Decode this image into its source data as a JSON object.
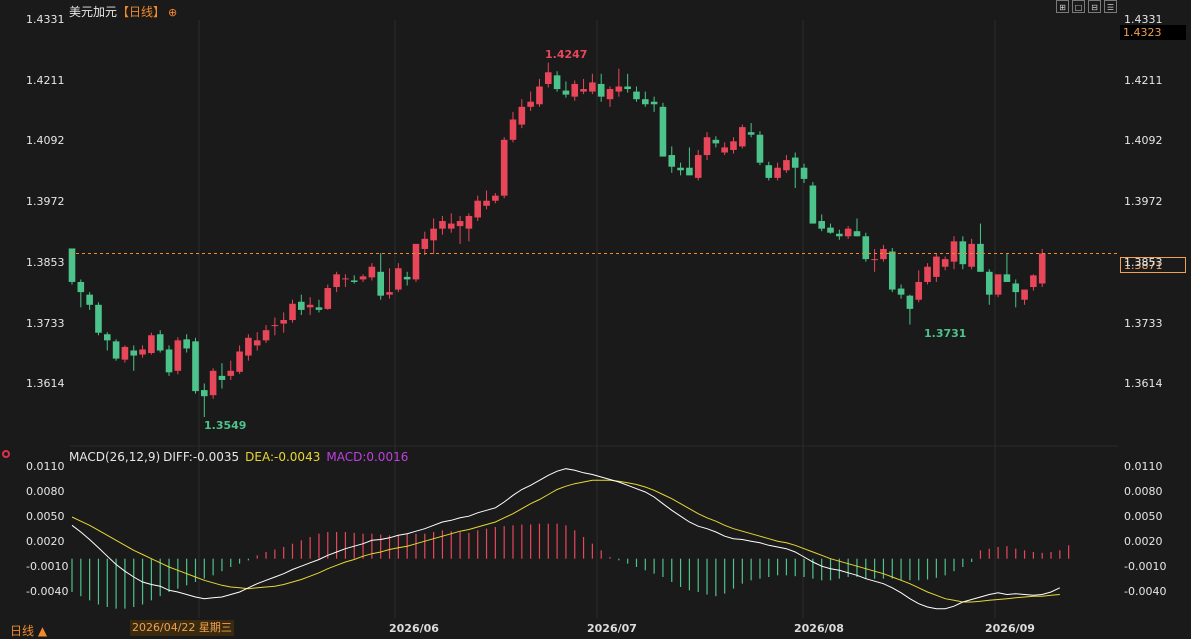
{
  "header": {
    "symbol": "美元加元",
    "period": "【日线】",
    "add_icon": "plus-circle-icon",
    "toolbar_icons": [
      "layout-grid-icon",
      "single-pane-icon",
      "split-pane-icon",
      "triple-pane-icon"
    ]
  },
  "price_axis": {
    "ticks": [
      "1.4331",
      "1.4211",
      "1.4092",
      "1.3972",
      "1.3853",
      "1.3733",
      "1.3614"
    ],
    "top_value_box": "1.4323",
    "current_price_box": "1.3871"
  },
  "annotations": {
    "high": "1.4247",
    "low1": "1.3549",
    "low2": "1.3731"
  },
  "macd": {
    "title": "MACD(26,12,9)",
    "diff_label": "DIFF:-0.0035",
    "dea_label": "DEA:-0.0043",
    "macd_label": "MACD:0.0016",
    "ticks": [
      "0.0110",
      "0.0080",
      "0.0050",
      "0.0020",
      "-0.0010",
      "-0.0040"
    ]
  },
  "x_axis": {
    "period_label": "日线 ▲",
    "crosshair_date": "2026/04/22 星期三",
    "labels": [
      "2026/06",
      "2026/07",
      "2026/08",
      "2026/09"
    ]
  },
  "colors": {
    "up": "#e8475a",
    "down": "#4cc38a",
    "dea": "#e6d832",
    "diff": "#ffffff",
    "macd_label": "#c040e0",
    "accent": "#f08a2a"
  },
  "chart_data": [
    {
      "type": "candlestick",
      "title": "美元加元【日线】",
      "ylim": [
        1.353,
        1.4331
      ],
      "y_ticks": [
        1.4331,
        1.4211,
        1.4092,
        1.3972,
        1.3853,
        1.3733,
        1.3614
      ],
      "current_price": 1.3871,
      "candles": [
        {
          "o": 1.3881,
          "h": 1.3872,
          "l": 1.381,
          "c": 1.3815
        },
        {
          "o": 1.3815,
          "h": 1.382,
          "l": 1.3765,
          "c": 1.3795
        },
        {
          "o": 1.379,
          "h": 1.3795,
          "l": 1.376,
          "c": 1.377
        },
        {
          "o": 1.377,
          "h": 1.3775,
          "l": 1.371,
          "c": 1.3715
        },
        {
          "o": 1.3712,
          "h": 1.3716,
          "l": 1.368,
          "c": 1.37
        },
        {
          "o": 1.3698,
          "h": 1.3702,
          "l": 1.366,
          "c": 1.3664
        },
        {
          "o": 1.3662,
          "h": 1.369,
          "l": 1.3656,
          "c": 1.3687
        },
        {
          "o": 1.368,
          "h": 1.369,
          "l": 1.364,
          "c": 1.367
        },
        {
          "o": 1.3672,
          "h": 1.369,
          "l": 1.3666,
          "c": 1.3682
        },
        {
          "o": 1.3675,
          "h": 1.3715,
          "l": 1.3672,
          "c": 1.371
        },
        {
          "o": 1.3712,
          "h": 1.372,
          "l": 1.3676,
          "c": 1.368
        },
        {
          "o": 1.3682,
          "h": 1.369,
          "l": 1.363,
          "c": 1.3637
        },
        {
          "o": 1.364,
          "h": 1.3706,
          "l": 1.3633,
          "c": 1.37
        },
        {
          "o": 1.3702,
          "h": 1.3712,
          "l": 1.3676,
          "c": 1.3684
        },
        {
          "o": 1.3698,
          "h": 1.3705,
          "l": 1.3595,
          "c": 1.36
        },
        {
          "o": 1.3602,
          "h": 1.3615,
          "l": 1.3549,
          "c": 1.359
        },
        {
          "o": 1.3592,
          "h": 1.3645,
          "l": 1.3585,
          "c": 1.364
        },
        {
          "o": 1.363,
          "h": 1.3655,
          "l": 1.3605,
          "c": 1.3622
        },
        {
          "o": 1.363,
          "h": 1.366,
          "l": 1.3622,
          "c": 1.364
        },
        {
          "o": 1.3638,
          "h": 1.369,
          "l": 1.3634,
          "c": 1.3678
        },
        {
          "o": 1.367,
          "h": 1.3712,
          "l": 1.366,
          "c": 1.3705
        },
        {
          "o": 1.369,
          "h": 1.3716,
          "l": 1.368,
          "c": 1.37
        },
        {
          "o": 1.37,
          "h": 1.373,
          "l": 1.3695,
          "c": 1.372
        },
        {
          "o": 1.373,
          "h": 1.3745,
          "l": 1.371,
          "c": 1.373
        },
        {
          "o": 1.3733,
          "h": 1.3755,
          "l": 1.3715,
          "c": 1.374
        },
        {
          "o": 1.374,
          "h": 1.378,
          "l": 1.3735,
          "c": 1.3772
        },
        {
          "o": 1.3776,
          "h": 1.379,
          "l": 1.375,
          "c": 1.376
        },
        {
          "o": 1.3765,
          "h": 1.3785,
          "l": 1.375,
          "c": 1.377
        },
        {
          "o": 1.3765,
          "h": 1.378,
          "l": 1.3755,
          "c": 1.376
        },
        {
          "o": 1.3762,
          "h": 1.381,
          "l": 1.376,
          "c": 1.3803
        },
        {
          "o": 1.3805,
          "h": 1.3835,
          "l": 1.3795,
          "c": 1.383
        },
        {
          "o": 1.382,
          "h": 1.383,
          "l": 1.3805,
          "c": 1.3822
        },
        {
          "o": 1.3818,
          "h": 1.3828,
          "l": 1.3812,
          "c": 1.3815
        },
        {
          "o": 1.382,
          "h": 1.383,
          "l": 1.3815,
          "c": 1.3826
        },
        {
          "o": 1.3824,
          "h": 1.3852,
          "l": 1.3818,
          "c": 1.3845
        },
        {
          "o": 1.3835,
          "h": 1.3872,
          "l": 1.378,
          "c": 1.3788
        },
        {
          "o": 1.379,
          "h": 1.3842,
          "l": 1.3782,
          "c": 1.3795
        },
        {
          "o": 1.38,
          "h": 1.3852,
          "l": 1.3795,
          "c": 1.3842
        },
        {
          "o": 1.3825,
          "h": 1.3835,
          "l": 1.3808,
          "c": 1.382
        },
        {
          "o": 1.382,
          "h": 1.389,
          "l": 1.3815,
          "c": 1.389
        },
        {
          "o": 1.388,
          "h": 1.3914,
          "l": 1.3868,
          "c": 1.39
        },
        {
          "o": 1.3897,
          "h": 1.394,
          "l": 1.387,
          "c": 1.392
        },
        {
          "o": 1.392,
          "h": 1.3945,
          "l": 1.3908,
          "c": 1.3935
        },
        {
          "o": 1.392,
          "h": 1.395,
          "l": 1.3912,
          "c": 1.393
        },
        {
          "o": 1.3925,
          "h": 1.3945,
          "l": 1.389,
          "c": 1.3935
        },
        {
          "o": 1.392,
          "h": 1.395,
          "l": 1.3895,
          "c": 1.3945
        },
        {
          "o": 1.3942,
          "h": 1.3985,
          "l": 1.3935,
          "c": 1.3975
        },
        {
          "o": 1.3965,
          "h": 1.3995,
          "l": 1.3958,
          "c": 1.3975
        },
        {
          "o": 1.3975,
          "h": 1.399,
          "l": 1.397,
          "c": 1.3985
        },
        {
          "o": 1.3985,
          "h": 1.41,
          "l": 1.398,
          "c": 1.4095
        },
        {
          "o": 1.4095,
          "h": 1.415,
          "l": 1.409,
          "c": 1.4135
        },
        {
          "o": 1.4125,
          "h": 1.4175,
          "l": 1.4118,
          "c": 1.416
        },
        {
          "o": 1.416,
          "h": 1.419,
          "l": 1.4152,
          "c": 1.417
        },
        {
          "o": 1.4165,
          "h": 1.4215,
          "l": 1.416,
          "c": 1.42
        },
        {
          "o": 1.4205,
          "h": 1.4247,
          "l": 1.4198,
          "c": 1.4228
        },
        {
          "o": 1.4222,
          "h": 1.423,
          "l": 1.419,
          "c": 1.4195
        },
        {
          "o": 1.4192,
          "h": 1.421,
          "l": 1.4178,
          "c": 1.4184
        },
        {
          "o": 1.418,
          "h": 1.4212,
          "l": 1.4172,
          "c": 1.4205
        },
        {
          "o": 1.419,
          "h": 1.4215,
          "l": 1.4185,
          "c": 1.4195
        },
        {
          "o": 1.419,
          "h": 1.4225,
          "l": 1.4185,
          "c": 1.4208
        },
        {
          "o": 1.4205,
          "h": 1.4225,
          "l": 1.417,
          "c": 1.418
        },
        {
          "o": 1.4175,
          "h": 1.42,
          "l": 1.416,
          "c": 1.4195
        },
        {
          "o": 1.419,
          "h": 1.4235,
          "l": 1.418,
          "c": 1.42
        },
        {
          "o": 1.42,
          "h": 1.4225,
          "l": 1.4188,
          "c": 1.4195
        },
        {
          "o": 1.419,
          "h": 1.42,
          "l": 1.417,
          "c": 1.4175
        },
        {
          "o": 1.4175,
          "h": 1.419,
          "l": 1.416,
          "c": 1.4165
        },
        {
          "o": 1.417,
          "h": 1.418,
          "l": 1.415,
          "c": 1.4165
        },
        {
          "o": 1.416,
          "h": 1.4168,
          "l": 1.4075,
          "c": 1.4062
        },
        {
          "o": 1.4065,
          "h": 1.4082,
          "l": 1.403,
          "c": 1.4042
        },
        {
          "o": 1.404,
          "h": 1.405,
          "l": 1.4025,
          "c": 1.4035
        },
        {
          "o": 1.404,
          "h": 1.408,
          "l": 1.403,
          "c": 1.4025
        },
        {
          "o": 1.402,
          "h": 1.4075,
          "l": 1.4015,
          "c": 1.4065
        },
        {
          "o": 1.4065,
          "h": 1.411,
          "l": 1.4055,
          "c": 1.41
        },
        {
          "o": 1.4095,
          "h": 1.4102,
          "l": 1.408,
          "c": 1.4088
        },
        {
          "o": 1.407,
          "h": 1.409,
          "l": 1.4065,
          "c": 1.408
        },
        {
          "o": 1.4075,
          "h": 1.41,
          "l": 1.4068,
          "c": 1.4092
        },
        {
          "o": 1.4082,
          "h": 1.4125,
          "l": 1.4078,
          "c": 1.412
        },
        {
          "o": 1.411,
          "h": 1.4128,
          "l": 1.41,
          "c": 1.4105
        },
        {
          "o": 1.4105,
          "h": 1.4112,
          "l": 1.4045,
          "c": 1.405
        },
        {
          "o": 1.4045,
          "h": 1.4052,
          "l": 1.4015,
          "c": 1.402
        },
        {
          "o": 1.402,
          "h": 1.405,
          "l": 1.4015,
          "c": 1.404
        },
        {
          "o": 1.4035,
          "h": 1.4065,
          "l": 1.403,
          "c": 1.4055
        },
        {
          "o": 1.406,
          "h": 1.407,
          "l": 1.4,
          "c": 1.404
        },
        {
          "o": 1.404,
          "h": 1.4048,
          "l": 1.401,
          "c": 1.4018
        },
        {
          "o": 1.4005,
          "h": 1.4012,
          "l": 1.396,
          "c": 1.393
        },
        {
          "o": 1.3935,
          "h": 1.3948,
          "l": 1.3915,
          "c": 1.392
        },
        {
          "o": 1.3922,
          "h": 1.393,
          "l": 1.391,
          "c": 1.3912
        },
        {
          "o": 1.391,
          "h": 1.3918,
          "l": 1.3898,
          "c": 1.3905
        },
        {
          "o": 1.3905,
          "h": 1.3925,
          "l": 1.39,
          "c": 1.392
        },
        {
          "o": 1.3915,
          "h": 1.394,
          "l": 1.3908,
          "c": 1.3905
        },
        {
          "o": 1.3905,
          "h": 1.3912,
          "l": 1.3855,
          "c": 1.386
        },
        {
          "o": 1.386,
          "h": 1.388,
          "l": 1.3835,
          "c": 1.386
        },
        {
          "o": 1.386,
          "h": 1.3888,
          "l": 1.3855,
          "c": 1.388
        },
        {
          "o": 1.3875,
          "h": 1.3882,
          "l": 1.3795,
          "c": 1.38
        },
        {
          "o": 1.3802,
          "h": 1.381,
          "l": 1.3782,
          "c": 1.379
        },
        {
          "o": 1.3788,
          "h": 1.379,
          "l": 1.3731,
          "c": 1.3762
        },
        {
          "o": 1.378,
          "h": 1.3838,
          "l": 1.3775,
          "c": 1.3815
        },
        {
          "o": 1.3815,
          "h": 1.3852,
          "l": 1.381,
          "c": 1.3845
        },
        {
          "o": 1.3825,
          "h": 1.387,
          "l": 1.3815,
          "c": 1.3865
        },
        {
          "o": 1.3845,
          "h": 1.3865,
          "l": 1.3838,
          "c": 1.386
        },
        {
          "o": 1.3855,
          "h": 1.3905,
          "l": 1.384,
          "c": 1.3895
        },
        {
          "o": 1.3895,
          "h": 1.3905,
          "l": 1.384,
          "c": 1.385
        },
        {
          "o": 1.3845,
          "h": 1.39,
          "l": 1.384,
          "c": 1.389
        },
        {
          "o": 1.389,
          "h": 1.393,
          "l": 1.3885,
          "c": 1.3835
        },
        {
          "o": 1.3835,
          "h": 1.384,
          "l": 1.377,
          "c": 1.379
        },
        {
          "o": 1.379,
          "h": 1.382,
          "l": 1.3785,
          "c": 1.383
        },
        {
          "o": 1.383,
          "h": 1.387,
          "l": 1.3825,
          "c": 1.3815
        },
        {
          "o": 1.3812,
          "h": 1.382,
          "l": 1.3765,
          "c": 1.3795
        },
        {
          "o": 1.378,
          "h": 1.38,
          "l": 1.377,
          "c": 1.38
        },
        {
          "o": 1.3805,
          "h": 1.383,
          "l": 1.3798,
          "c": 1.3828
        },
        {
          "o": 1.3812,
          "h": 1.388,
          "l": 1.3805,
          "c": 1.3871
        }
      ]
    },
    {
      "type": "macd",
      "title": "MACD(26,12,9)",
      "ylim": [
        -0.0075,
        0.0115
      ],
      "y_ticks": [
        0.011,
        0.008,
        0.005,
        0.002,
        -0.001,
        -0.004
      ],
      "diff": [
        0.004,
        0.0032,
        0.0023,
        0.0013,
        0.0003,
        -0.0007,
        -0.0015,
        -0.0022,
        -0.0028,
        -0.0031,
        -0.0033,
        -0.0038,
        -0.004,
        -0.0043,
        -0.0046,
        -0.0048,
        -0.0047,
        -0.0046,
        -0.0043,
        -0.004,
        -0.0035,
        -0.003,
        -0.0026,
        -0.0022,
        -0.0018,
        -0.0013,
        -0.0009,
        -0.0005,
        -0.0001,
        0.0004,
        0.0008,
        0.0012,
        0.0015,
        0.0018,
        0.0022,
        0.0023,
        0.0025,
        0.0028,
        0.003,
        0.0033,
        0.0036,
        0.004,
        0.0044,
        0.0046,
        0.0049,
        0.0051,
        0.0055,
        0.0058,
        0.0061,
        0.0068,
        0.0076,
        0.0083,
        0.0088,
        0.0094,
        0.01,
        0.0105,
        0.0108,
        0.0106,
        0.0103,
        0.0101,
        0.0098,
        0.0095,
        0.0092,
        0.0088,
        0.0084,
        0.008,
        0.0074,
        0.0066,
        0.0058,
        0.0051,
        0.0044,
        0.0039,
        0.0036,
        0.0032,
        0.0027,
        0.0024,
        0.0023,
        0.0021,
        0.0019,
        0.0016,
        0.0014,
        0.0012,
        0.0008,
        0.0002,
        -0.0004,
        -0.0009,
        -0.0012,
        -0.0014,
        -0.0017,
        -0.002,
        -0.0024,
        -0.0027,
        -0.003,
        -0.0035,
        -0.0041,
        -0.0048,
        -0.0054,
        -0.0058,
        -0.006,
        -0.006,
        -0.0057,
        -0.0052,
        -0.0049,
        -0.0046,
        -0.0043,
        -0.0041,
        -0.0043,
        -0.0042,
        -0.0043,
        -0.0044,
        -0.0043,
        -0.004,
        -0.0035
      ],
      "dea": [
        0.005,
        0.0045,
        0.004,
        0.0034,
        0.0028,
        0.0022,
        0.0016,
        0.001,
        0.0005,
        0.0,
        -0.0005,
        -0.001,
        -0.0014,
        -0.0018,
        -0.0022,
        -0.0026,
        -0.0029,
        -0.0032,
        -0.0034,
        -0.0035,
        -0.0036,
        -0.0035,
        -0.0034,
        -0.0033,
        -0.0031,
        -0.0028,
        -0.0025,
        -0.0021,
        -0.0017,
        -0.0012,
        -0.0008,
        -0.0004,
        -0.0001,
        0.0003,
        0.0006,
        0.0008,
        0.0011,
        0.0013,
        0.0015,
        0.0018,
        0.0021,
        0.0024,
        0.0027,
        0.003,
        0.0033,
        0.0035,
        0.0038,
        0.0041,
        0.0044,
        0.0049,
        0.0054,
        0.006,
        0.0066,
        0.0071,
        0.0077,
        0.0083,
        0.0087,
        0.009,
        0.0092,
        0.0094,
        0.0094,
        0.0094,
        0.0093,
        0.0091,
        0.0089,
        0.0086,
        0.0082,
        0.0077,
        0.0072,
        0.0066,
        0.006,
        0.0054,
        0.0049,
        0.0045,
        0.004,
        0.0036,
        0.0033,
        0.003,
        0.0027,
        0.0024,
        0.0021,
        0.0019,
        0.0016,
        0.0012,
        0.0008,
        0.0004,
        0.0,
        -0.0003,
        -0.0006,
        -0.0009,
        -0.0012,
        -0.0015,
        -0.0018,
        -0.0022,
        -0.0026,
        -0.003,
        -0.0035,
        -0.004,
        -0.0044,
        -0.0048,
        -0.005,
        -0.0052,
        -0.0052,
        -0.0051,
        -0.005,
        -0.0049,
        -0.0048,
        -0.0047,
        -0.0046,
        -0.0045,
        -0.0045,
        -0.0044,
        -0.0043
      ],
      "macd": [
        -0.004,
        -0.0045,
        -0.005,
        -0.0055,
        -0.0058,
        -0.006,
        -0.006,
        -0.0058,
        -0.0055,
        -0.005,
        -0.0045,
        -0.004,
        -0.0036,
        -0.0032,
        -0.0028,
        -0.0024,
        -0.002,
        -0.0015,
        -0.001,
        -0.0006,
        -0.0002,
        0.0004,
        0.0008,
        0.0011,
        0.0014,
        0.0018,
        0.0022,
        0.0026,
        0.003,
        0.0032,
        0.0032,
        0.0032,
        0.0031,
        0.003,
        0.003,
        0.0029,
        0.0028,
        0.0028,
        0.003,
        0.003,
        0.003,
        0.0032,
        0.0034,
        0.0033,
        0.0032,
        0.0031,
        0.0034,
        0.0036,
        0.0038,
        0.0039,
        0.004,
        0.0041,
        0.0041,
        0.0042,
        0.0042,
        0.0042,
        0.004,
        0.0034,
        0.0026,
        0.0018,
        0.001,
        0.0002,
        -0.0002,
        -0.0006,
        -0.001,
        -0.0014,
        -0.0018,
        -0.0022,
        -0.0028,
        -0.0034,
        -0.0038,
        -0.004,
        -0.0043,
        -0.0045,
        -0.0042,
        -0.0036,
        -0.003,
        -0.0026,
        -0.0024,
        -0.0022,
        -0.002,
        -0.002,
        -0.0021,
        -0.0022,
        -0.0024,
        -0.0026,
        -0.0026,
        -0.0024,
        -0.0022,
        -0.0022,
        -0.0024,
        -0.0024,
        -0.0024,
        -0.0024,
        -0.0026,
        -0.0026,
        -0.0026,
        -0.0025,
        -0.0023,
        -0.002,
        -0.0015,
        -0.001,
        -0.0004,
        0.001,
        0.0012,
        0.0014,
        0.0015,
        0.0012,
        0.001,
        0.0008,
        0.0007,
        0.0008,
        0.001,
        0.0016
      ]
    }
  ]
}
